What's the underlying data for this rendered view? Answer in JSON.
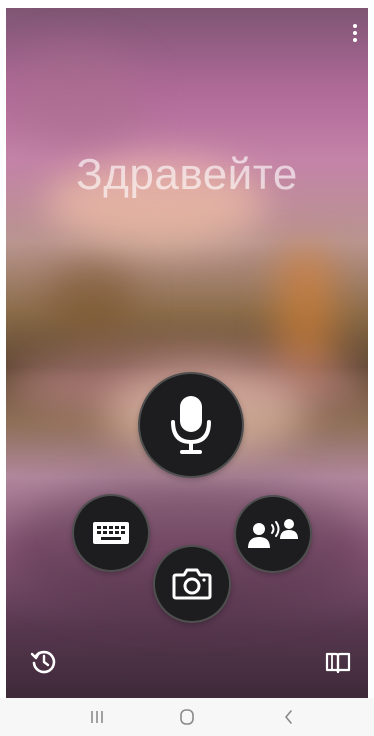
{
  "main": {
    "greeting": "Здравейте"
  },
  "icons": {
    "overflow_menu": "more-vert-icon",
    "microphone": "microphone-icon",
    "keyboard": "keyboard-icon",
    "camera": "camera-icon",
    "conversation": "conversation-icon",
    "history": "history-icon",
    "phrasebook": "phrasebook-icon"
  },
  "navigation": {
    "recents": "recents-icon",
    "home": "home-icon",
    "back": "back-icon"
  },
  "colors": {
    "button_background": "#1d1d1f",
    "icon_color": "#ffffff",
    "nav_bar_background": "#f7f7f7",
    "nav_icon_color": "#8a8a8a"
  }
}
